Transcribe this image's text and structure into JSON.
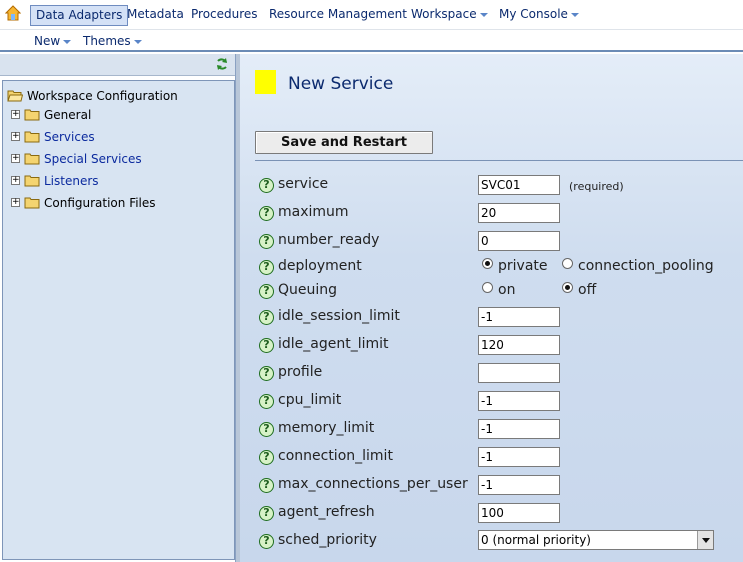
{
  "menu": {
    "home_icon": "home-icon",
    "items": [
      "Data Adapters",
      "Metadata",
      "Procedures",
      "Resource Management",
      "Workspace",
      "My Console"
    ]
  },
  "submenu": {
    "items": [
      "New",
      "Themes"
    ]
  },
  "tree": {
    "root": "Workspace Configuration",
    "children": [
      "General",
      "Services",
      "Special Services",
      "Listeners",
      "Configuration Files"
    ]
  },
  "form": {
    "title": "New Service",
    "save_label": "Save and Restart",
    "help_glyph": "?",
    "required_note": "(required)",
    "fields": {
      "service": {
        "label": "service",
        "value": "SVC01"
      },
      "maximum": {
        "label": "maximum",
        "value": "20"
      },
      "number_ready": {
        "label": "number_ready",
        "value": "0"
      },
      "deployment": {
        "label": "deployment",
        "options": [
          "private",
          "connection_pooling"
        ],
        "selected": "private"
      },
      "queuing": {
        "label": "Queuing",
        "options": [
          "on",
          "off"
        ],
        "selected": "off"
      },
      "idle_session_limit": {
        "label": "idle_session_limit",
        "value": "-1"
      },
      "idle_agent_limit": {
        "label": "idle_agent_limit",
        "value": "120"
      },
      "profile": {
        "label": "profile",
        "value": ""
      },
      "cpu_limit": {
        "label": "cpu_limit",
        "value": "-1"
      },
      "memory_limit": {
        "label": "memory_limit",
        "value": "-1"
      },
      "connection_limit": {
        "label": "connection_limit",
        "value": "-1"
      },
      "max_connections_per_user": {
        "label": "max_connections_per_user",
        "value": "-1"
      },
      "agent_refresh": {
        "label": "agent_refresh",
        "value": "100"
      },
      "sched_priority": {
        "label": "sched_priority",
        "value": "0 (normal priority)"
      }
    }
  },
  "colors": {
    "accent_square": "#ffff00",
    "link": "#0b2a6e",
    "panel_bg": "#cfddef"
  }
}
